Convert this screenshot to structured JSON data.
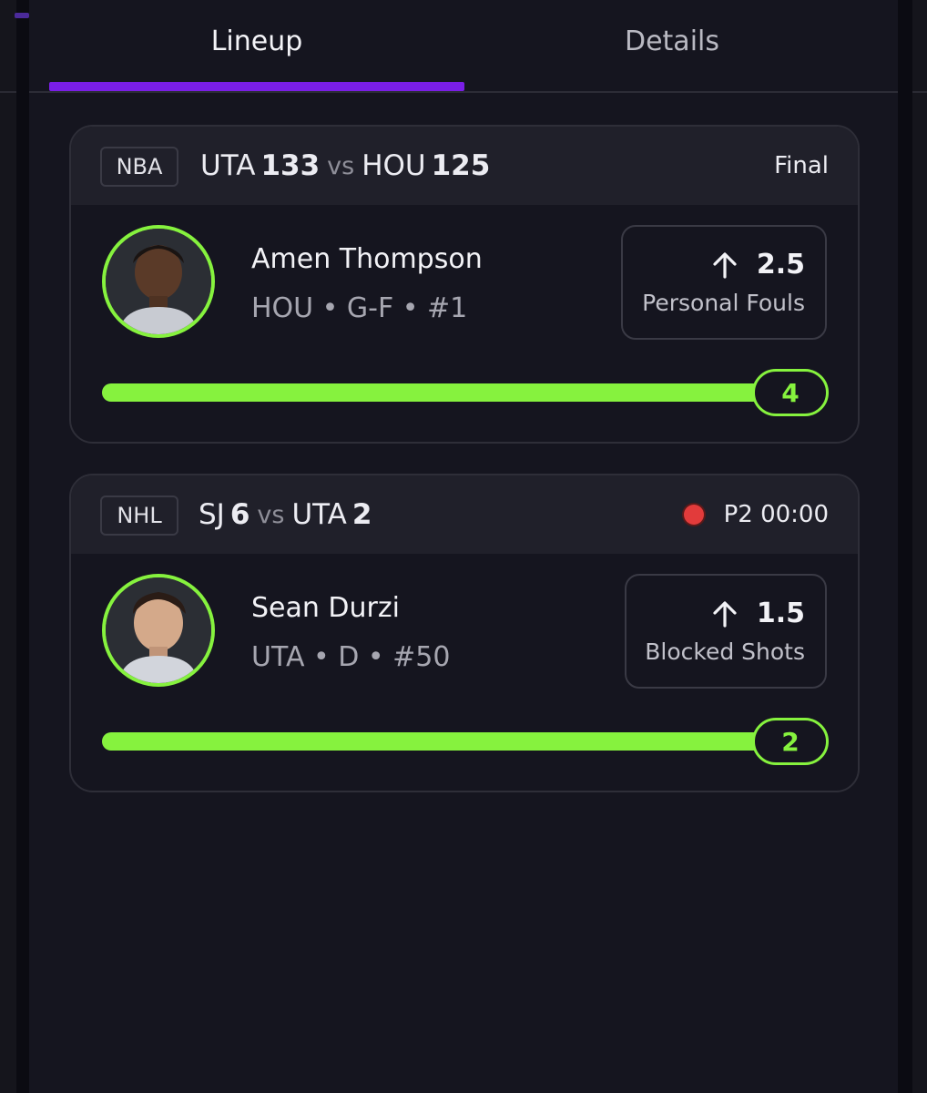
{
  "tabs": [
    {
      "label": "Lineup",
      "active": true
    },
    {
      "label": "Details",
      "active": false
    }
  ],
  "colors": {
    "accent": "#7a1ee6",
    "progress": "#86f23e",
    "live": "#e23b3b"
  },
  "cards": [
    {
      "league": "NBA",
      "away_team": "UTA",
      "away_score": "133",
      "vs": "vs",
      "home_team": "HOU",
      "home_score": "125",
      "status": "Final",
      "live": false,
      "player_name": "Amen Thompson",
      "player_meta": "HOU • G-F • #1",
      "avatar_icon": "player-headshot",
      "direction_icon": "arrow-up-icon",
      "line": "2.5",
      "stat_label": "Personal Fouls",
      "result": "4",
      "progress_fraction": 1.0
    },
    {
      "league": "NHL",
      "away_team": "SJ",
      "away_score": "6",
      "vs": "vs",
      "home_team": "UTA",
      "home_score": "2",
      "status": "P2 00:00",
      "live": true,
      "player_name": "Sean Durzi",
      "player_meta": "UTA • D • #50",
      "avatar_icon": "player-headshot",
      "direction_icon": "arrow-up-icon",
      "line": "1.5",
      "stat_label": "Blocked Shots",
      "result": "2",
      "progress_fraction": 1.0
    }
  ]
}
